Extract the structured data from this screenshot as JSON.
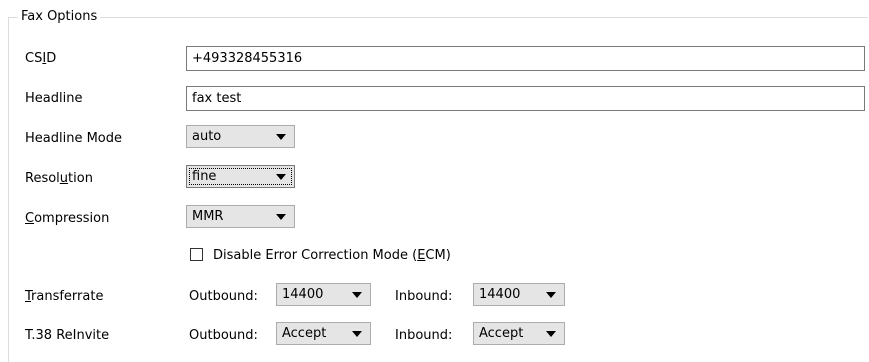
{
  "group": {
    "legend": "Fax Options"
  },
  "csid": {
    "label_pre": "CS",
    "label_mn": "I",
    "label_post": "D",
    "value": "+493328455316"
  },
  "headline": {
    "label": "Headline",
    "value": "fax test"
  },
  "headline_mode": {
    "label": "Headline Mode",
    "value": "auto"
  },
  "resolution": {
    "label_pre": "Resol",
    "label_mn": "u",
    "label_post": "tion",
    "value": "fine"
  },
  "compression": {
    "label_mn": "C",
    "label_post": "ompression",
    "value": "MMR"
  },
  "ecm": {
    "label_pre": "Disable Error Correction Mode (",
    "label_mn": "E",
    "label_post": "CM)",
    "checked": false
  },
  "transferrate": {
    "label_mn": "T",
    "label_post": "ransferrate",
    "outbound_label": "Outbound:",
    "outbound_value": "14400",
    "inbound_label": "Inbound:",
    "inbound_value": "14400"
  },
  "t38": {
    "label": "T.38 ReInvite",
    "outbound_label": "Outbound:",
    "outbound_value": "Accept",
    "inbound_label": "Inbound:",
    "inbound_value": "Accept"
  }
}
